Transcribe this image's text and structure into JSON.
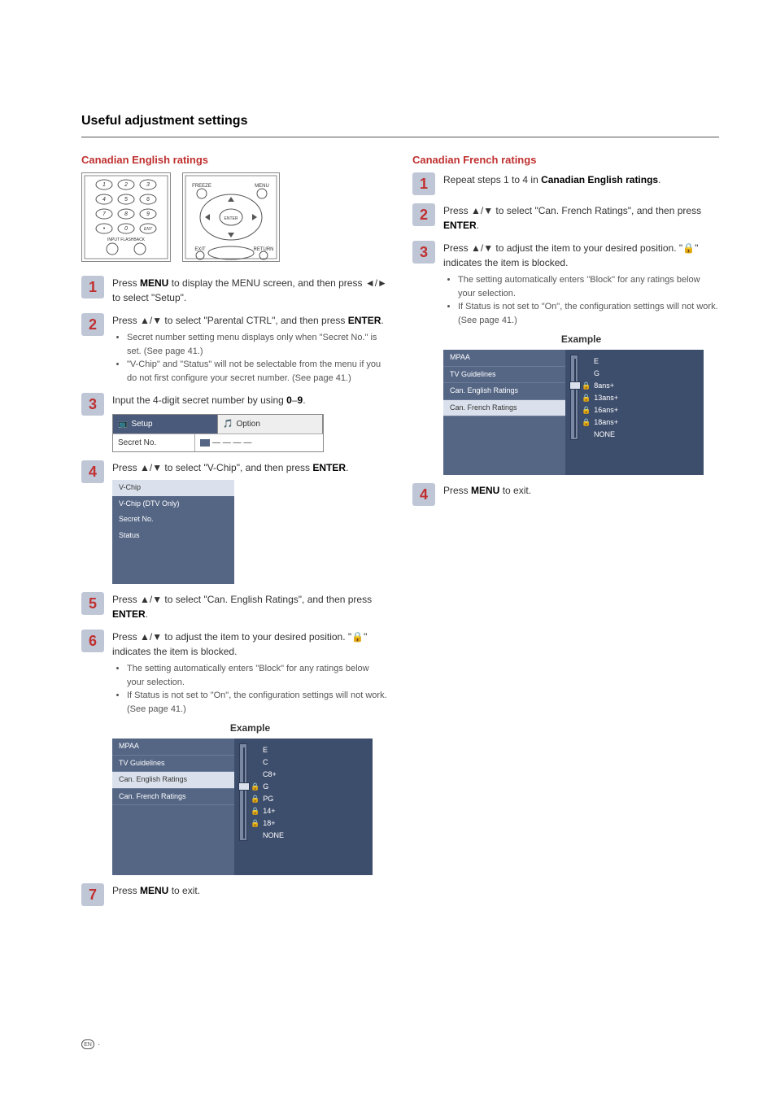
{
  "sectionTitle": "Useful adjustment settings",
  "left": {
    "subhead": "Canadian English ratings",
    "remote": {
      "buttons": [
        "1",
        "2",
        "3",
        "4",
        "5",
        "6",
        "7",
        "8",
        "9",
        "0"
      ],
      "dotLabel": "•",
      "entLabel": "ENT",
      "inputLabel": "INPUT FLASHBACK"
    },
    "navpad": {
      "freeze": "FREEZE",
      "menu": "MENU",
      "enter": "ENTER",
      "exit": "EXIT",
      "return": "RETURN"
    },
    "steps": [
      {
        "num": "1",
        "body": [
          "Press ",
          [
            "b",
            "MENU"
          ],
          " to display the MENU screen, and then press ◄/► to select \"Setup\"."
        ]
      },
      {
        "num": "2",
        "body": [
          "Press ▲/▼ to select \"Parental CTRL\", and then press ",
          [
            "b",
            "ENTER"
          ],
          "."
        ],
        "bullets": [
          "Secret number setting menu displays only when \"Secret No.\" is set. (See page 41.)",
          "\"V-Chip\" and \"Status\" will not be selectable from the menu if you do not first configure your secret number. (See page 41.)"
        ]
      },
      {
        "num": "3",
        "body": [
          "Input the 4-digit secret number by using ",
          [
            "b",
            "0"
          ],
          "–",
          [
            "b",
            "9"
          ],
          "."
        ],
        "osdSetup": {
          "tab1": "Setup",
          "tab2": "Option",
          "rowLabel": "Secret No.",
          "rowValue": "— — — —"
        }
      },
      {
        "num": "4",
        "body": [
          "Press ▲/▼ to select \"V-Chip\", and then press ",
          [
            "b",
            "ENTER"
          ],
          "."
        ],
        "vchip": [
          "V-Chip",
          "V-Chip (DTV Only)",
          "Secret No.",
          "Status"
        ]
      },
      {
        "num": "5",
        "body": [
          "Press ▲/▼ to select \"Can. English Ratings\", and then press ",
          [
            "b",
            "ENTER"
          ],
          "."
        ]
      },
      {
        "num": "6",
        "body": [
          "Press ▲/▼ to adjust the item to your desired position. \"🔒\" indicates the item is blocked."
        ],
        "bullets": [
          "The setting automatically enters \"Block\" for any ratings below your selection.",
          "If Status is not set to \"On\", the configuration settings will not work. (See page 41.)"
        ],
        "exampleLabel": "Example",
        "example": {
          "left": [
            "MPAA",
            "TV Guidelines",
            "Can. English Ratings",
            "Can. French Ratings"
          ],
          "selectedIndex": 2,
          "ratings": [
            {
              "label": "E",
              "lock": false
            },
            {
              "label": "C",
              "lock": false
            },
            {
              "label": "C8+",
              "lock": false
            },
            {
              "label": "G",
              "lock": true
            },
            {
              "label": "PG",
              "lock": true
            },
            {
              "label": "14+",
              "lock": true
            },
            {
              "label": "18+",
              "lock": true
            },
            {
              "label": "NONE",
              "lock": false
            }
          ],
          "cursorIndex": 3
        }
      },
      {
        "num": "7",
        "body": [
          "Press ",
          [
            "b",
            "MENU"
          ],
          " to exit."
        ]
      }
    ]
  },
  "right": {
    "subhead": "Canadian French ratings",
    "steps": [
      {
        "num": "1",
        "body": [
          "Repeat steps 1 to 4 in ",
          [
            "b",
            "Canadian English ratings"
          ],
          "."
        ]
      },
      {
        "num": "2",
        "body": [
          "Press ▲/▼ to select \"Can. French Ratings\", and then press ",
          [
            "b",
            "ENTER"
          ],
          "."
        ]
      },
      {
        "num": "3",
        "body": [
          "Press ▲/▼ to adjust the item to your desired position. \"🔒\" indicates the item is blocked."
        ],
        "bullets": [
          "The setting automatically enters \"Block\" for any ratings below your selection.",
          "If Status is not set to \"On\", the configuration settings will not work. (See page 41.)"
        ],
        "exampleLabel": "Example",
        "example": {
          "left": [
            "MPAA",
            "TV Guidelines",
            "Can. English Ratings",
            "Can. French Ratings"
          ],
          "selectedIndex": 3,
          "ratings": [
            {
              "label": "E",
              "lock": false
            },
            {
              "label": "G",
              "lock": false
            },
            {
              "label": "8ans+",
              "lock": true
            },
            {
              "label": "13ans+",
              "lock": true
            },
            {
              "label": "16ans+",
              "lock": true
            },
            {
              "label": "18ans+",
              "lock": true
            },
            {
              "label": "NONE",
              "lock": false
            }
          ],
          "cursorIndex": 2
        }
      },
      {
        "num": "4",
        "body": [
          "Press ",
          [
            "b",
            "MENU"
          ],
          " to exit."
        ]
      }
    ]
  },
  "footer": "EN ·"
}
